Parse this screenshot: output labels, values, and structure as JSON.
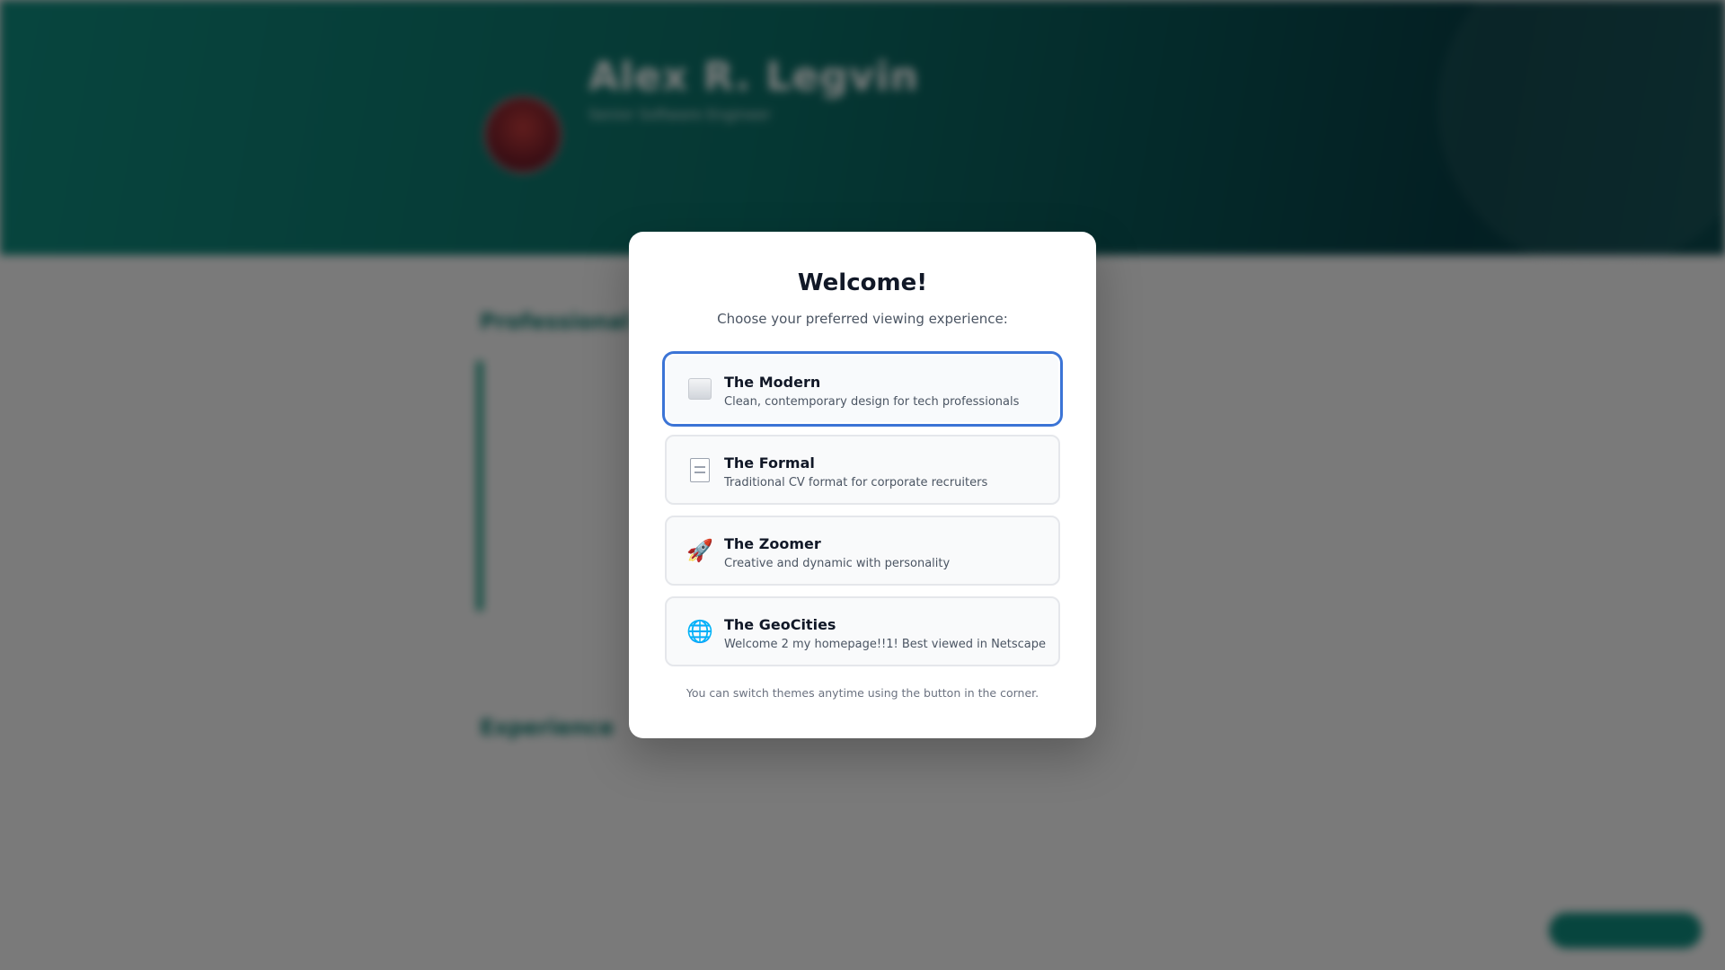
{
  "background": {
    "name": "Alex R. Legvin",
    "role": "Senior Software Engineer",
    "bio": "",
    "links": [
      "",
      "",
      ""
    ],
    "sections": {
      "about_title": "Professional",
      "experience_title": "Experience"
    },
    "about_text": "",
    "theme_button_label": "",
    "colors": {
      "hero_start": "#0f8b7d",
      "hero_end": "#073f46",
      "accent": "#2aa089"
    }
  },
  "modal": {
    "title": "Welcome!",
    "subtitle": "Choose your preferred viewing experience:",
    "options": [
      {
        "icon": "square-icon",
        "name": "The Modern",
        "description": "Clean, contemporary design for tech professionals",
        "selected": true
      },
      {
        "icon": "document-icon",
        "glyph": "",
        "name": "The Formal",
        "description": "Traditional CV format for corporate recruiters",
        "selected": false
      },
      {
        "icon": "rocket-icon",
        "glyph": "🚀",
        "name": "The Zoomer",
        "description": "Creative and dynamic with personality",
        "selected": false
      },
      {
        "icon": "globe-icon",
        "glyph": "🌐",
        "name": "The GeoCities",
        "description": "Welcome 2 my homepage!!1! Best viewed in Netscape",
        "selected": false
      }
    ],
    "footnote": "You can switch themes anytime using the button in the corner.",
    "colors": {
      "selected_ring": "#3b74d6"
    }
  }
}
